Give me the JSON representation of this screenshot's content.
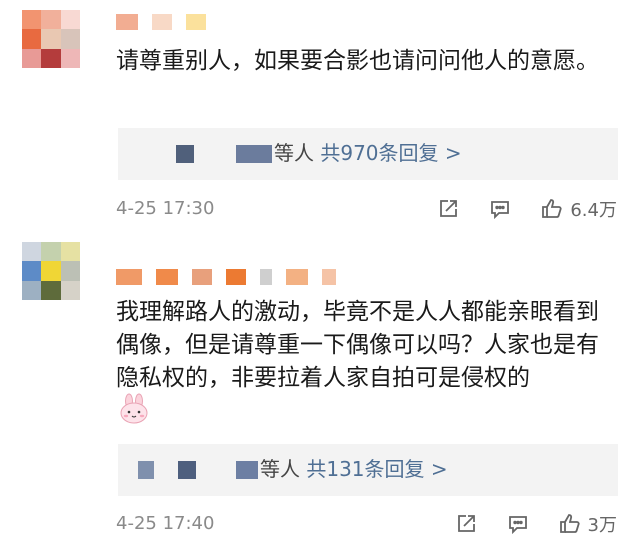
{
  "comments": [
    {
      "text": "请尊重别人，如果要合影也请问问他人的意愿。",
      "reply": {
        "who": "等人",
        "count": "共970条回复 >"
      },
      "time": "4-25 17:30",
      "likes": "6.4万",
      "avatar_colors": [
        "#f29470",
        "#f1b09b",
        "#f8d9d3",
        "#e86a40",
        "#e9c8b2",
        "#d8c4ba",
        "#e89a96",
        "#b43c3c",
        "#eeb7b7"
      ],
      "name_colors": [
        "#f2ad92",
        "#f8d9c6",
        "#fbe19c"
      ]
    },
    {
      "text": "我理解路人的激动，毕竟不是人人都能亲眼看到偶像，但是请尊重一下偶像可以吗？人家也是有隐私权的，非要拉着人家自拍可是侵权的",
      "reply": {
        "who": "等人",
        "count": "共131条回复 >"
      },
      "time": "4-25 17:40",
      "likes": "3万",
      "avatar_colors": [
        "#cfd6e0",
        "#c4d1ad",
        "#e6e1a3",
        "#5d8bc7",
        "#f0d635",
        "#bcc0b5",
        "#9db0c2",
        "#5e6b3b",
        "#d6d2c8"
      ],
      "name_colors": [
        "#f09a67",
        "#f08a4a",
        "#e8a07c",
        "#ec7a32",
        "#cfcfcf",
        "#f3b183",
        "#f5c3a6"
      ]
    }
  ],
  "icons": {
    "share": "share-icon",
    "comment": "comment-icon",
    "like": "like-icon",
    "emoji": "bunny-emoji-icon"
  }
}
